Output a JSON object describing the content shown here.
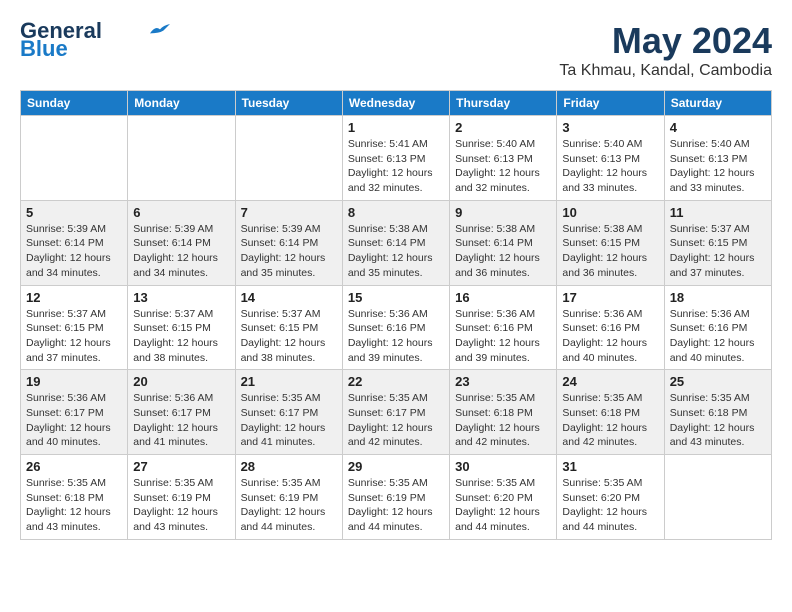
{
  "header": {
    "logo_line1": "General",
    "logo_line2": "Blue",
    "month_year": "May 2024",
    "location": "Ta Khmau, Kandal, Cambodia"
  },
  "days_of_week": [
    "Sunday",
    "Monday",
    "Tuesday",
    "Wednesday",
    "Thursday",
    "Friday",
    "Saturday"
  ],
  "weeks": [
    [
      {
        "day": "",
        "info": ""
      },
      {
        "day": "",
        "info": ""
      },
      {
        "day": "",
        "info": ""
      },
      {
        "day": "1",
        "info": "Sunrise: 5:41 AM\nSunset: 6:13 PM\nDaylight: 12 hours\nand 32 minutes."
      },
      {
        "day": "2",
        "info": "Sunrise: 5:40 AM\nSunset: 6:13 PM\nDaylight: 12 hours\nand 32 minutes."
      },
      {
        "day": "3",
        "info": "Sunrise: 5:40 AM\nSunset: 6:13 PM\nDaylight: 12 hours\nand 33 minutes."
      },
      {
        "day": "4",
        "info": "Sunrise: 5:40 AM\nSunset: 6:13 PM\nDaylight: 12 hours\nand 33 minutes."
      }
    ],
    [
      {
        "day": "5",
        "info": "Sunrise: 5:39 AM\nSunset: 6:14 PM\nDaylight: 12 hours\nand 34 minutes."
      },
      {
        "day": "6",
        "info": "Sunrise: 5:39 AM\nSunset: 6:14 PM\nDaylight: 12 hours\nand 34 minutes."
      },
      {
        "day": "7",
        "info": "Sunrise: 5:39 AM\nSunset: 6:14 PM\nDaylight: 12 hours\nand 35 minutes."
      },
      {
        "day": "8",
        "info": "Sunrise: 5:38 AM\nSunset: 6:14 PM\nDaylight: 12 hours\nand 35 minutes."
      },
      {
        "day": "9",
        "info": "Sunrise: 5:38 AM\nSunset: 6:14 PM\nDaylight: 12 hours\nand 36 minutes."
      },
      {
        "day": "10",
        "info": "Sunrise: 5:38 AM\nSunset: 6:15 PM\nDaylight: 12 hours\nand 36 minutes."
      },
      {
        "day": "11",
        "info": "Sunrise: 5:37 AM\nSunset: 6:15 PM\nDaylight: 12 hours\nand 37 minutes."
      }
    ],
    [
      {
        "day": "12",
        "info": "Sunrise: 5:37 AM\nSunset: 6:15 PM\nDaylight: 12 hours\nand 37 minutes."
      },
      {
        "day": "13",
        "info": "Sunrise: 5:37 AM\nSunset: 6:15 PM\nDaylight: 12 hours\nand 38 minutes."
      },
      {
        "day": "14",
        "info": "Sunrise: 5:37 AM\nSunset: 6:15 PM\nDaylight: 12 hours\nand 38 minutes."
      },
      {
        "day": "15",
        "info": "Sunrise: 5:36 AM\nSunset: 6:16 PM\nDaylight: 12 hours\nand 39 minutes."
      },
      {
        "day": "16",
        "info": "Sunrise: 5:36 AM\nSunset: 6:16 PM\nDaylight: 12 hours\nand 39 minutes."
      },
      {
        "day": "17",
        "info": "Sunrise: 5:36 AM\nSunset: 6:16 PM\nDaylight: 12 hours\nand 40 minutes."
      },
      {
        "day": "18",
        "info": "Sunrise: 5:36 AM\nSunset: 6:16 PM\nDaylight: 12 hours\nand 40 minutes."
      }
    ],
    [
      {
        "day": "19",
        "info": "Sunrise: 5:36 AM\nSunset: 6:17 PM\nDaylight: 12 hours\nand 40 minutes."
      },
      {
        "day": "20",
        "info": "Sunrise: 5:36 AM\nSunset: 6:17 PM\nDaylight: 12 hours\nand 41 minutes."
      },
      {
        "day": "21",
        "info": "Sunrise: 5:35 AM\nSunset: 6:17 PM\nDaylight: 12 hours\nand 41 minutes."
      },
      {
        "day": "22",
        "info": "Sunrise: 5:35 AM\nSunset: 6:17 PM\nDaylight: 12 hours\nand 42 minutes."
      },
      {
        "day": "23",
        "info": "Sunrise: 5:35 AM\nSunset: 6:18 PM\nDaylight: 12 hours\nand 42 minutes."
      },
      {
        "day": "24",
        "info": "Sunrise: 5:35 AM\nSunset: 6:18 PM\nDaylight: 12 hours\nand 42 minutes."
      },
      {
        "day": "25",
        "info": "Sunrise: 5:35 AM\nSunset: 6:18 PM\nDaylight: 12 hours\nand 43 minutes."
      }
    ],
    [
      {
        "day": "26",
        "info": "Sunrise: 5:35 AM\nSunset: 6:18 PM\nDaylight: 12 hours\nand 43 minutes."
      },
      {
        "day": "27",
        "info": "Sunrise: 5:35 AM\nSunset: 6:19 PM\nDaylight: 12 hours\nand 43 minutes."
      },
      {
        "day": "28",
        "info": "Sunrise: 5:35 AM\nSunset: 6:19 PM\nDaylight: 12 hours\nand 44 minutes."
      },
      {
        "day": "29",
        "info": "Sunrise: 5:35 AM\nSunset: 6:19 PM\nDaylight: 12 hours\nand 44 minutes."
      },
      {
        "day": "30",
        "info": "Sunrise: 5:35 AM\nSunset: 6:20 PM\nDaylight: 12 hours\nand 44 minutes."
      },
      {
        "day": "31",
        "info": "Sunrise: 5:35 AM\nSunset: 6:20 PM\nDaylight: 12 hours\nand 44 minutes."
      },
      {
        "day": "",
        "info": ""
      }
    ]
  ]
}
